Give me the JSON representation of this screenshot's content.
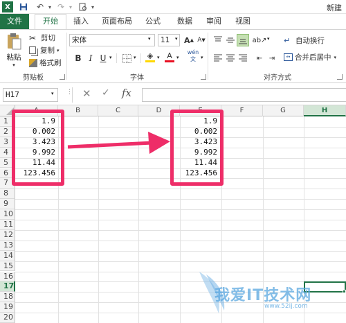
{
  "titlebar": {
    "app_title": "新建"
  },
  "tabs": {
    "file": "文件",
    "home": "开始",
    "insert": "插入",
    "page_layout": "页面布局",
    "formulas": "公式",
    "data": "数据",
    "review": "审阅",
    "view": "视图"
  },
  "ribbon": {
    "paste": "粘贴",
    "cut": "剪切",
    "copy": "复制",
    "format_painter": "格式刷",
    "clipboard_group": "剪贴板",
    "font_name": "宋体",
    "font_size": "11",
    "bold": "B",
    "italic": "I",
    "underline": "U",
    "font_color": "A",
    "wen": "wén 文",
    "font_group": "字体",
    "wrap_text": "自动换行",
    "merge_center": "合并后居中",
    "alignment_group": "对齐方式"
  },
  "formula_bar": {
    "name_box": "H17",
    "fx": "fx",
    "cancel": "✕",
    "enter": "✓"
  },
  "sheet": {
    "columns": [
      "A",
      "B",
      "C",
      "D",
      "E",
      "F",
      "G",
      "H"
    ],
    "rows": [
      "1",
      "2",
      "3",
      "4",
      "5",
      "6",
      "7",
      "8",
      "9",
      "10",
      "11",
      "12",
      "13",
      "14",
      "15",
      "16",
      "17",
      "18",
      "19",
      "20"
    ],
    "col_a_values": [
      "1.9",
      "0.002",
      "3.423",
      "9.992",
      "11.44",
      "123.456"
    ],
    "col_e_values": [
      "1.9",
      "0.002",
      "3.423",
      "9.992",
      "11.44",
      "123.456"
    ],
    "selected_cell": "H17"
  },
  "watermark": {
    "text": "我爱IT技术网",
    "url": "www.52ij.com"
  },
  "colors": {
    "excel_green": "#217346",
    "highlight_pink": "#ee2d68"
  }
}
